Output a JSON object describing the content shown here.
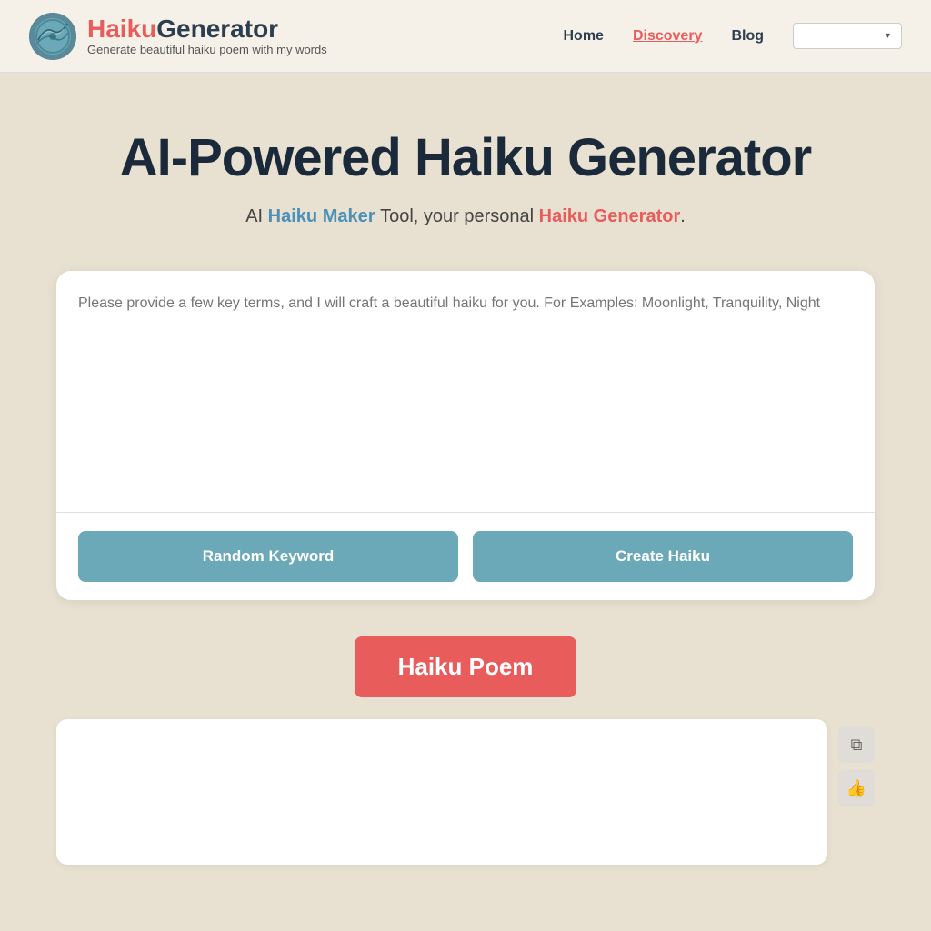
{
  "header": {
    "logo": {
      "haiku": "Haiku",
      "generator": "Generator",
      "subtitle": "Generate beautiful haiku poem with my words"
    },
    "nav": {
      "home": "Home",
      "discovery": "Discovery",
      "blog": "Blog",
      "dropdown_placeholder": ""
    }
  },
  "main": {
    "hero_title": "AI-Powered Haiku Generator",
    "hero_subtitle_prefix": "AI",
    "hero_subtitle_haiku_maker": "Haiku Maker",
    "hero_subtitle_middle": "Tool, your personal",
    "hero_subtitle_haiku_generator": "Haiku Generator",
    "hero_subtitle_suffix": ".",
    "textarea_placeholder": "Please provide a few key terms, and I will craft a beautiful haiku for you. For Examples: Moonlight, Tranquility, Night",
    "btn_random": "Random Keyword",
    "btn_create": "Create Haiku",
    "haiku_poem_badge": "Haiku Poem",
    "copy_icon": "⧉",
    "like_icon": "👍"
  }
}
